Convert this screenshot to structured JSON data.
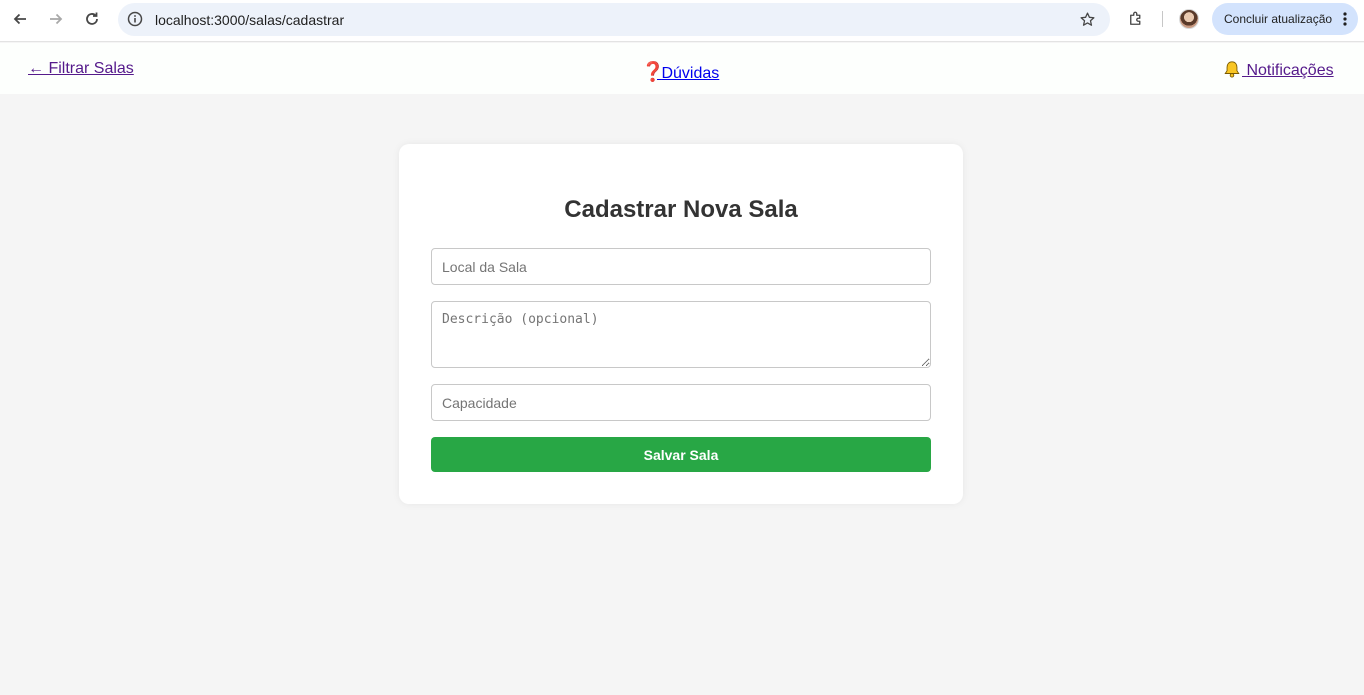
{
  "browser": {
    "url": "localhost:3000/salas/cadastrar",
    "update_button_label": "Concluir atualização"
  },
  "header": {
    "back_link": "← Filtrar Salas",
    "help_link": "Dúvidas",
    "help_emoji": "❓",
    "notifications_link": "Notificações"
  },
  "form": {
    "title": "Cadastrar Nova Sala",
    "local_placeholder": "Local da Sala",
    "local_value": "",
    "description_placeholder": "Descrição (opcional)",
    "description_value": "",
    "capacity_placeholder": "Capacidade",
    "capacity_value": "",
    "submit_label": "Salvar Sala"
  },
  "colors": {
    "submit_button": "#28a745",
    "page_background": "#f5f5f5",
    "omnibox_background": "#edf2fa",
    "update_button_background": "#d3e3fd"
  },
  "icons": [
    "back-arrow-icon",
    "forward-arrow-icon",
    "reload-icon",
    "site-info-icon",
    "bookmark-star-icon",
    "extensions-icon",
    "profile-avatar",
    "more-menu-icon",
    "question-icon",
    "bell-icon"
  ]
}
